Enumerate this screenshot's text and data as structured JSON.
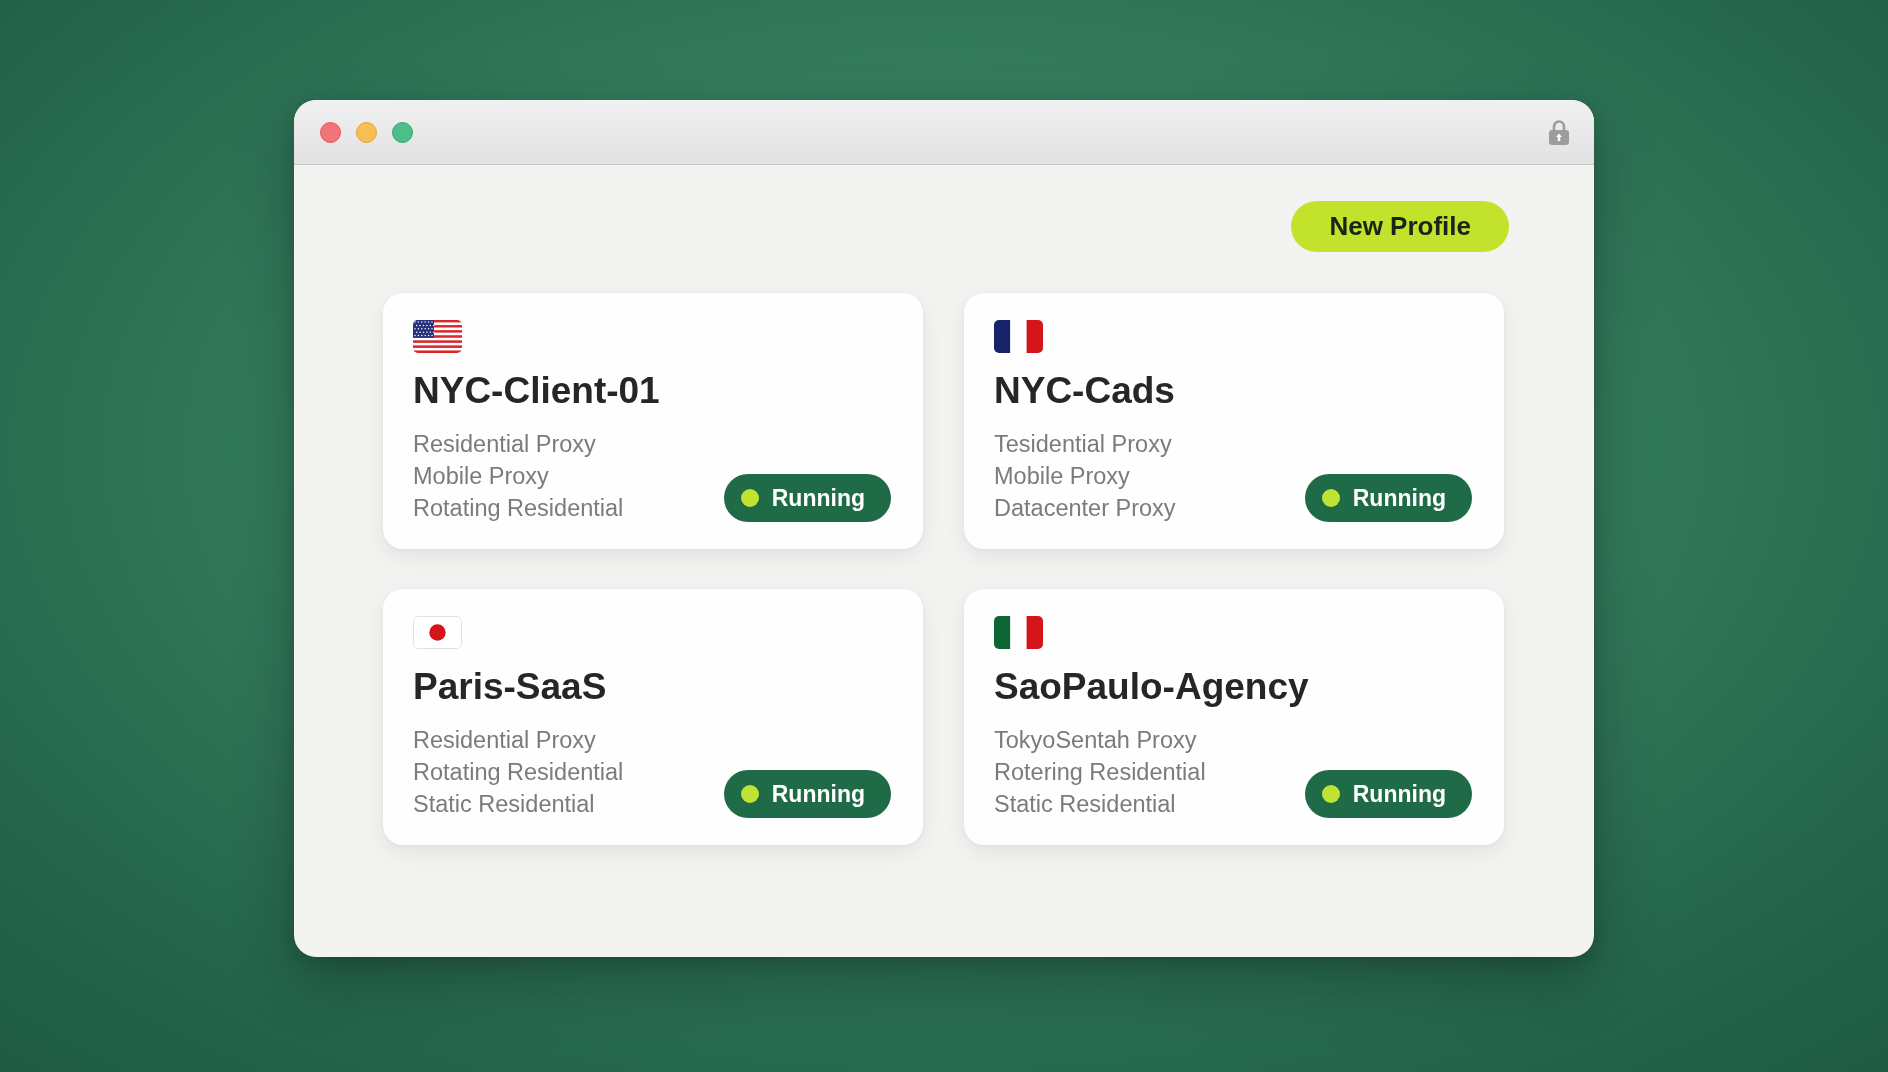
{
  "toolbar": {
    "new_profile_button": "New Profile"
  },
  "profiles": [
    {
      "kind": "us",
      "name": "NYC-Client-01",
      "proxies": [
        "Residential Proxy",
        "Mobile Proxy",
        "Rotating Residential"
      ],
      "status": "Running"
    },
    {
      "kind": "fr",
      "name": "NYC-Cads",
      "proxies": [
        "Tesidential Proxy",
        "Mobile Proxy",
        "Datacenter Proxy"
      ],
      "status": "Running"
    },
    {
      "kind": "jp",
      "name": "Paris-SaaS",
      "proxies": [
        "Residential Proxy",
        "Rotating Residential",
        "Static Residential"
      ],
      "status": "Running"
    },
    {
      "kind": "it",
      "name": "SaoPaulo-Agency",
      "proxies": [
        "TokyoSentah Proxy",
        "Rotering Residential",
        "Static Residential"
      ],
      "status": "Running"
    }
  ]
}
